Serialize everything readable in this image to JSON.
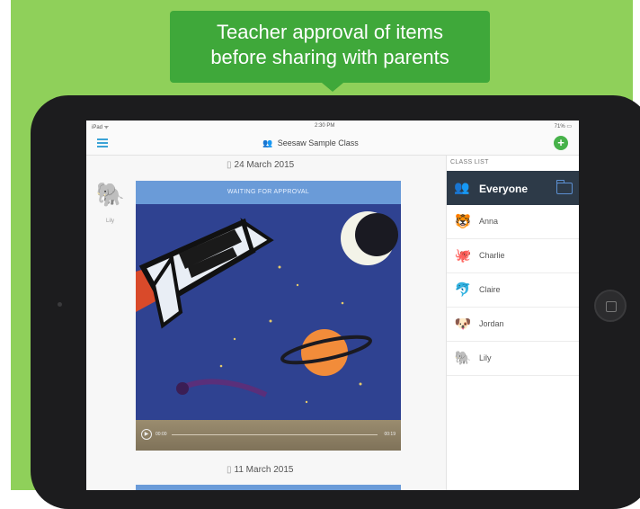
{
  "callout": {
    "line1": "Teacher approval of items",
    "line2": "before sharing with parents"
  },
  "colors": {
    "background": "#8fd05a",
    "callout": "#3fa83a",
    "sidebar_selected": "#2d3a48",
    "approval_banner": "#6a9bd8",
    "accent_blue": "#3ba3d6",
    "add_button": "#47b24a"
  },
  "statusbar": {
    "carrier": "iPad ᯤ",
    "time": "2:30 PM",
    "battery": "71% ▭"
  },
  "navbar": {
    "menu_icon": "hamburger-menu-icon",
    "title": "Seesaw Sample Class",
    "add_icon": "plus-circle-icon"
  },
  "feed": {
    "dates": [
      "24 March 2015",
      "11 March 2015"
    ],
    "post": {
      "author": "Lily",
      "status_banner": "WAITING FOR APPROVAL",
      "elapsed": "00:00",
      "duration": "00:19"
    }
  },
  "sidebar": {
    "header": "CLASS LIST",
    "everyone": "Everyone",
    "students": [
      {
        "name": "Anna",
        "avatar": "tiger"
      },
      {
        "name": "Charlie",
        "avatar": "octopus"
      },
      {
        "name": "Claire",
        "avatar": "dolphin"
      },
      {
        "name": "Jordan",
        "avatar": "dog"
      },
      {
        "name": "Lily",
        "avatar": "elephant"
      }
    ]
  }
}
